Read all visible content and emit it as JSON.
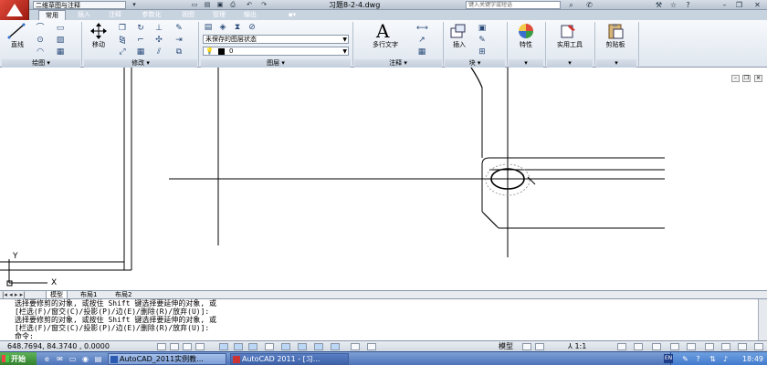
{
  "titlebar": {
    "workspace": "二维草图与注释",
    "doc_title": "习题8-2-4.dwg",
    "search_placeholder": "键入关键字或短语",
    "icons": [
      "new-icon",
      "open-icon",
      "save-icon",
      "print-icon",
      "undo-icon",
      "redo-icon",
      "binoculars-icon",
      "star-icon",
      "help-icon",
      "minimize-icon",
      "restore-icon",
      "close-icon"
    ]
  },
  "ribbon_tabs": [
    "常用",
    "插入",
    "注释",
    "参数化",
    "视图",
    "管理",
    "输出"
  ],
  "ribbon": {
    "draw": {
      "line_label": "直线",
      "title": "绘图"
    },
    "modify": {
      "move_label": "移动",
      "title": "修改"
    },
    "layers": {
      "state": "未保存的图层状态",
      "current": "0",
      "title": "图层"
    },
    "annotation": {
      "mtext_label": "多行文字",
      "title": "注释"
    },
    "block": {
      "insert_label": "插入",
      "title": "块"
    },
    "properties": {
      "label": "特性"
    },
    "utilities": {
      "label": "实用工具"
    },
    "clipboard": {
      "label": "剪贴板"
    }
  },
  "layout_tabs": [
    "模型",
    "布局1",
    "布局2"
  ],
  "command_lines": [
    "选择要修剪的对象, 或按住 Shift 键选择要延伸的对象, 或",
    "[栏选(F)/窗交(C)/投影(P)/边(E)/删除(R)/放弃(U)]:",
    "选择要修剪的对象, 或按住 Shift 键选择要延伸的对象, 或",
    "[栏选(F)/窗交(C)/投影(P)/边(E)/删除(R)/放弃(U)]:",
    "命令:"
  ],
  "statusbar": {
    "coords": "648.7694, 84.3740 , 0.0000",
    "model": "模型",
    "scale": "1:1"
  },
  "taskbar": {
    "start": "开始",
    "items": [
      "AutoCAD_2011实例教...",
      "AutoCAD 2011 - [习..."
    ],
    "lang": "EN",
    "clock": "18:49"
  },
  "colors": {
    "accent": "#c8d3e0",
    "title_red": "#c8302a",
    "taskbar": "#4e74b8"
  }
}
